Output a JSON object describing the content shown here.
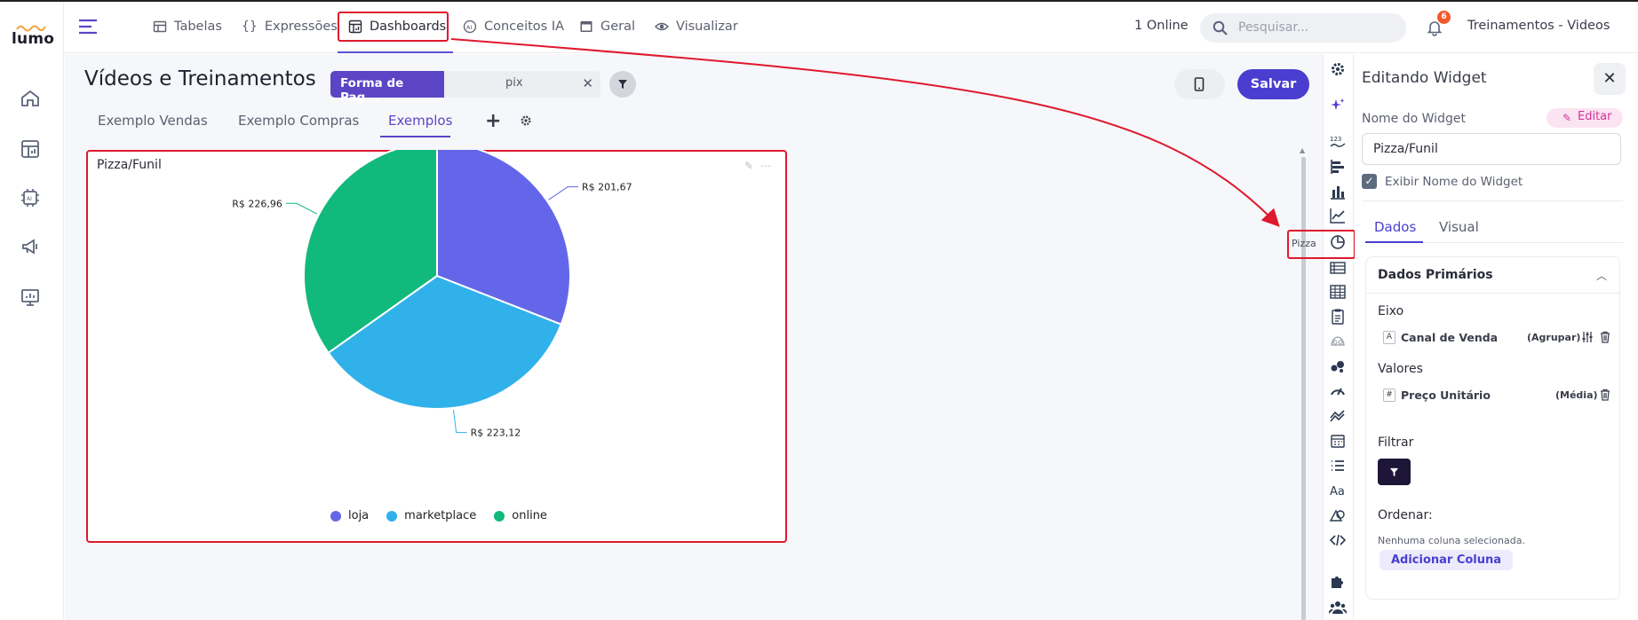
{
  "app": {
    "logo_text": "lumo",
    "online": "1 Online",
    "user": "Treinamentos - Videos",
    "notifications": "6"
  },
  "nav": {
    "items": [
      {
        "label": "Tabelas",
        "icon": "table-icon"
      },
      {
        "label": "Expressões",
        "icon": "braces-icon"
      },
      {
        "label": "Dashboards",
        "icon": "dashboard-icon"
      },
      {
        "label": "Conceitos IA",
        "icon": "ai-icon"
      },
      {
        "label": "Geral",
        "icon": "window-icon"
      },
      {
        "label": "Visualizar",
        "icon": "eye-icon"
      }
    ]
  },
  "search": {
    "placeholder": "Pesquisar..."
  },
  "page": {
    "title": "Vídeos e Treinamentos",
    "filter_label": "Forma de Pag...",
    "filter_value": "pix",
    "save": "Salvar",
    "tabs": [
      "Exemplo Vendas",
      "Exemplo Compras",
      "Exemplos"
    ]
  },
  "widget": {
    "title": "Pizza/Funil"
  },
  "chart_data": {
    "type": "pie",
    "title": "Pizza/Funil",
    "categories": [
      "loja",
      "marketplace",
      "online"
    ],
    "values": [
      201.67,
      223.12,
      226.96
    ],
    "labels": [
      "R$ 201,67",
      "R$ 223,12",
      "R$ 226,96"
    ],
    "colors": [
      "#6466e9",
      "#30b1ea",
      "#11b97d"
    ],
    "legend": "bottom"
  },
  "strip": {
    "tooltip": "Pizza"
  },
  "panel": {
    "title": "Editando Widget",
    "name_label": "Nome do Widget",
    "edit": "Editar",
    "name_value": "Pizza/Funil",
    "show_name": "Exibir Nome do Widget",
    "tabs": [
      "Dados",
      "Visual"
    ],
    "section_title": "Dados Primários",
    "axis_title": "Eixo",
    "axis_field": {
      "type": "A",
      "name": "Canal de Venda",
      "agg": "(Agrupar)"
    },
    "values_title": "Valores",
    "values_field": {
      "type": "#",
      "name": "Preço Unitário",
      "agg": "(Média)"
    },
    "filter_title": "Filtrar",
    "order_title": "Ordenar:",
    "no_column": "Nenhuma coluna selecionada.",
    "add_column": "Adicionar Coluna"
  }
}
